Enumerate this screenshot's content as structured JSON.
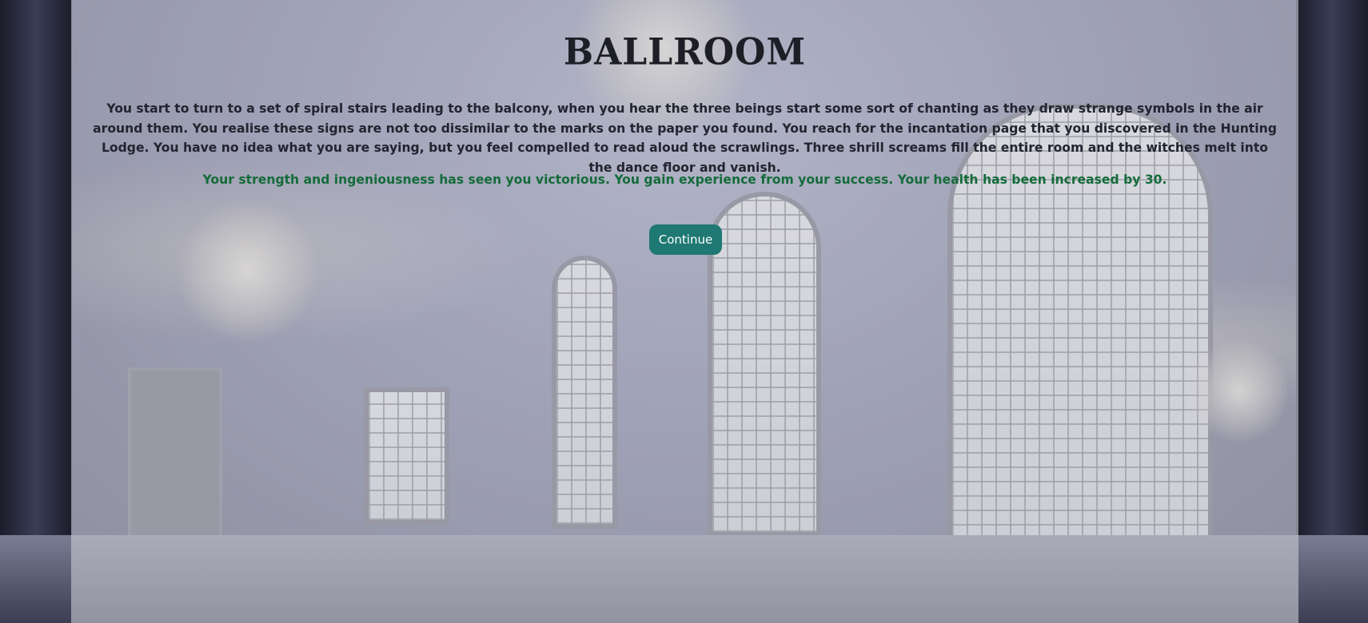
{
  "room": {
    "title": "BALLROOM"
  },
  "story": {
    "text": "You start to turn to a set of spiral stairs leading to the balcony, when you hear the three beings start some sort of chanting as they draw strange symbols in the air around them. You realise these signs are not too dissimilar to the marks on the paper you found. You reach for the incantation page that you discovered in the Hunting Lodge. You have no idea what you are saying, but you feel compelled to read aloud the scrawlings. Three shrill screams fill the entire room and the witches melt into the dance floor and vanish.",
    "outcome": "Your strength and ingeniousness has seen you victorious. You gain experience from your success. Your health has been increased by 30."
  },
  "actions": {
    "continue_label": "Continue"
  },
  "colors": {
    "outcome_text": "#146b3a",
    "button_bg": "#1f7873",
    "panel_overlay": "rgba(200,200,210,0.62)"
  }
}
